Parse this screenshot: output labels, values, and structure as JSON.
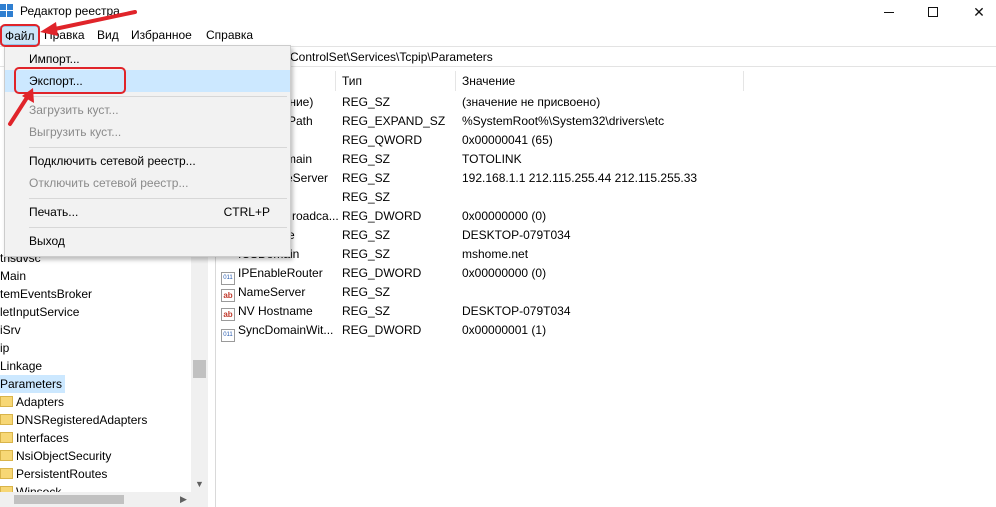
{
  "window": {
    "title": "Редактор реестра"
  },
  "menubar": {
    "items": [
      "Файл",
      "Правка",
      "Вид",
      "Избранное",
      "Справка"
    ]
  },
  "address": {
    "path": "ControlSet\\Services\\Tcpip\\Parameters"
  },
  "file_menu": {
    "import": "Импорт...",
    "export": "Экспорт...",
    "load_hive": "Загрузить куст...",
    "unload_hive": "Выгрузить куст...",
    "connect_network": "Подключить сетевой реестр...",
    "disconnect_network": "Отключить сетевой реестр...",
    "print": "Печать...",
    "print_shortcut": "CTRL+P",
    "exit": "Выход"
  },
  "tree": {
    "items": [
      "thsdvsc",
      "Main",
      "temEventsBroker",
      "letInputService",
      "iSrv",
      "ip",
      "Linkage",
      "Parameters",
      "Adapters",
      "DNSRegisteredAdapters",
      "Interfaces",
      "NsiObjectSecurity",
      "PersistentRoutes",
      "Winsock"
    ]
  },
  "list": {
    "columns": {
      "name": "",
      "type": "Тип",
      "value": "Значение"
    },
    "rows": [
      {
        "name": "ачение)",
        "type": "REG_SZ",
        "value": "(значение не присвоено)"
      },
      {
        "name": "Path",
        "type": "REG_EXPAND_SZ",
        "value": "%SystemRoot%\\System32\\drivers\\etc"
      },
      {
        "name": "",
        "type": "REG_QWORD",
        "value": "0x00000041 (65)"
      },
      {
        "name": "main",
        "type": "REG_SZ",
        "value": "TOTOLINK"
      },
      {
        "name": "eServer",
        "type": "REG_SZ",
        "value": "192.168.1.1 212.115.255.44 212.115.255.33"
      },
      {
        "name": "",
        "type": "REG_SZ",
        "value": ""
      },
      {
        "name": "roadca...",
        "type": "REG_DWORD",
        "value": "0x00000000 (0)"
      },
      {
        "name": "e",
        "type": "REG_SZ",
        "value": "DESKTOP-079T034"
      },
      {
        "name": "ICSDomain",
        "type": "REG_SZ",
        "value": "mshome.net"
      },
      {
        "name": "IPEnableRouter",
        "type": "REG_DWORD",
        "value": "0x00000000 (0)"
      },
      {
        "name": "NameServer",
        "type": "REG_SZ",
        "value": ""
      },
      {
        "name": "NV Hostname",
        "type": "REG_SZ",
        "value": "DESKTOP-079T034"
      },
      {
        "name": "SyncDomainWit...",
        "type": "REG_DWORD",
        "value": "0x00000001 (1)"
      }
    ]
  },
  "icons": {
    "string_value": "ab",
    "dword_value": "011"
  },
  "colors": {
    "annotation": "#e0242a",
    "menu_highlight": "#cce8ff",
    "selected_tree": "#cce8ff"
  }
}
